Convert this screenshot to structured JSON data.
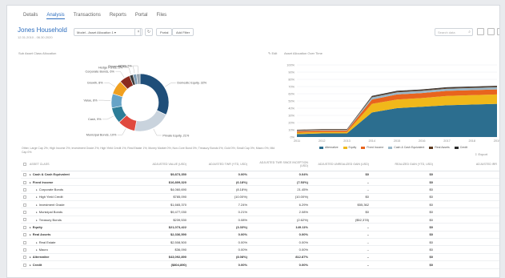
{
  "nav": {
    "tabs": [
      "Details",
      "Analysis",
      "Transactions",
      "Reports",
      "Portal",
      "Files"
    ],
    "active": 1
  },
  "header": {
    "title": "Jones Household",
    "subtitle": "12.31.2010 - 06.30.2020",
    "model_select": "Model - Asset Allocation 1 ▾",
    "portal_label": "Portal",
    "add_filter_label": "Add Filter",
    "search_placeholder": "Search data"
  },
  "donut": {
    "title": "Sub Asset Class Allocation",
    "edit_label": "Edit",
    "segments": [
      {
        "label": "Domestic Equity",
        "pct": "32%",
        "value": 32,
        "color": "#1f4e79"
      },
      {
        "label": "Private Equity",
        "pct": "21%",
        "value": 21,
        "color": "#c9d3dd"
      },
      {
        "label": "Municipal Bonds",
        "pct": "10%",
        "value": 10,
        "color": "#e04a3f"
      },
      {
        "label": "Cash",
        "pct": "9%",
        "value": 9,
        "color": "#2c7d98"
      },
      {
        "label": "Value",
        "pct": "8%",
        "value": 8,
        "color": "#66a3c7"
      },
      {
        "label": "Growth",
        "pct": "8%",
        "value": 8,
        "color": "#f0a020"
      },
      {
        "label": "Corporate Bonds",
        "pct": "6%",
        "value": 6,
        "color": "#8b2b1e"
      },
      {
        "label": "Hedge Funds",
        "pct": "2%",
        "value": 2,
        "color": "#3a3a3a"
      },
      {
        "label": "Reserves",
        "pct": "2%",
        "value": 2,
        "color": "#7e9db5"
      },
      {
        "label": "Other",
        "pct": "2%",
        "value": 2,
        "color": "#9aa6b1"
      }
    ]
  },
  "chart_data": {
    "type": "area",
    "title": "Asset Allocation Over Time",
    "x": [
      "2011",
      "2012",
      "2013",
      "2014",
      "2015",
      "2016",
      "2017",
      "2018",
      "2019"
    ],
    "ylim": [
      0,
      100
    ],
    "yticks": [
      "0%",
      "10%",
      "20%",
      "30%",
      "40%",
      "50%",
      "60%",
      "70%",
      "80%",
      "90%",
      "100%"
    ],
    "series": [
      {
        "name": "Alternative",
        "color": "#2c6e8f",
        "values": [
          4,
          5,
          5,
          34,
          40,
          42,
          44,
          45,
          46
        ]
      },
      {
        "name": "Equity",
        "color": "#f0b81a",
        "values": [
          2,
          2,
          2,
          12,
          12,
          12,
          13,
          13,
          13
        ]
      },
      {
        "name": "Fixed Income",
        "color": "#e8641e",
        "values": [
          2,
          2,
          2,
          6,
          7,
          7,
          7,
          7,
          7
        ]
      },
      {
        "name": "Cash & Cash Equivalent",
        "color": "#9ab8c9",
        "values": [
          1,
          1,
          1,
          3,
          3,
          3,
          3,
          3,
          3
        ]
      },
      {
        "name": "Real Assets",
        "color": "#5e3a20",
        "values": [
          1,
          1,
          1,
          1,
          1,
          1,
          1,
          1,
          1
        ]
      },
      {
        "name": "Credit",
        "color": "#2b2b2b",
        "values": [
          0,
          0,
          0,
          1,
          1,
          1,
          1,
          1,
          1
        ]
      }
    ]
  },
  "note": "Other, Large Cap 2%; High Income 2%; Investment Grade 2%; High Yield Credit 1%; Real Estate 1%; Money Market 0%; Non-Core Bond 0%; Treasury Bonds 0%; Gold 0%; Small Cap 0%; Macro 0%; Mid Cap 0%",
  "export_label": "Export",
  "table": {
    "columns": [
      "ASSET CLASS",
      "ADJUSTED VALUE (USD)",
      "ADJUSTED TWR (YTD, USD)",
      "ADJUSTED TWR SINCE INCEPTION (USD)",
      "ADJUSTED UNREALIZED GAIN (USD)",
      "REALIZED GAIN (YTD, USD)",
      "ADJUSTED IRR"
    ],
    "rows": [
      {
        "name": "Cash & Cash Equivalent",
        "level": 0,
        "value": "$9,873,350",
        "twr": "0.00%",
        "twr_class": "",
        "since": "0.04%",
        "since_class": "",
        "unreal": "$0",
        "unreal_class": "",
        "realized": "$0"
      },
      {
        "name": "Fixed Income",
        "level": 0,
        "value": "$16,809,320",
        "twr": "(6.18%)",
        "twr_class": "neg",
        "since": "(7.53%)",
        "since_class": "neg",
        "unreal": "–",
        "unreal_class": "",
        "realized": "$0"
      },
      {
        "name": "Corporate Bonds",
        "level": 1,
        "value": "$4,060,690",
        "twr": "(8.18%)",
        "twr_class": "neg",
        "since": "21.45%",
        "since_class": "",
        "unreal": "–",
        "unreal_class": "",
        "realized": "$0"
      },
      {
        "name": "High Yield Credit",
        "level": 1,
        "value": "$785,090",
        "twr": "(10.00%)",
        "twr_class": "neg",
        "since": "(10.00%)",
        "since_class": "neg",
        "unreal": "$0",
        "unreal_class": "",
        "realized": "$0"
      },
      {
        "name": "Investment Grade",
        "level": 1,
        "value": "$1,665,370",
        "twr": "7.24%",
        "twr_class": "",
        "since": "6.29%",
        "since_class": "",
        "unreal": "$55,362",
        "unreal_class": "",
        "realized": "$0"
      },
      {
        "name": "Municipal Bonds",
        "level": 1,
        "value": "$9,477,030",
        "twr": "0.21%",
        "twr_class": "",
        "since": "2.08%",
        "since_class": "",
        "unreal": "$0",
        "unreal_class": "",
        "realized": "$0"
      },
      {
        "name": "Treasury Bonds",
        "level": 1,
        "value": "$239,530",
        "twr": "0.08%",
        "twr_class": "neg",
        "since": "(2.62%)",
        "since_class": "neg",
        "unreal": "($52,378)",
        "unreal_class": "neg",
        "realized": "$0"
      },
      {
        "name": "Equity",
        "level": 0,
        "value": "$21,073,422",
        "twr": "(3.33%)",
        "twr_class": "neg",
        "since": "149.11%",
        "since_class": "",
        "unreal": "–",
        "unreal_class": "",
        "realized": "$0"
      },
      {
        "name": "Real Assets",
        "level": 0,
        "value": "$2,336,590",
        "twr": "0.00%",
        "twr_class": "",
        "since": "0.00%",
        "since_class": "",
        "unreal": "–",
        "unreal_class": "",
        "realized": "$0"
      },
      {
        "name": "Real Estate",
        "level": 1,
        "value": "$2,508,500",
        "twr": "0.00%",
        "twr_class": "",
        "since": "0.00%",
        "since_class": "",
        "unreal": "–",
        "unreal_class": "",
        "realized": "$0"
      },
      {
        "name": "Macro",
        "level": 1,
        "value": "$36,090",
        "twr": "0.00%",
        "twr_class": "",
        "since": "0.00%",
        "since_class": "",
        "unreal": "–",
        "unreal_class": "",
        "realized": "$0"
      },
      {
        "name": "Alternative",
        "level": 0,
        "value": "$43,092,890",
        "twr": "(8.08%)",
        "twr_class": "neg",
        "since": "812.87%",
        "since_class": "",
        "unreal": "–",
        "unreal_class": "",
        "realized": "$0"
      },
      {
        "name": "Credit",
        "level": 0,
        "value": "($804,890)",
        "twr": "0.00%",
        "twr_class": "",
        "since": "0.00%",
        "since_class": "",
        "unreal": "–",
        "unreal_class": "",
        "realized": "$0"
      }
    ]
  }
}
